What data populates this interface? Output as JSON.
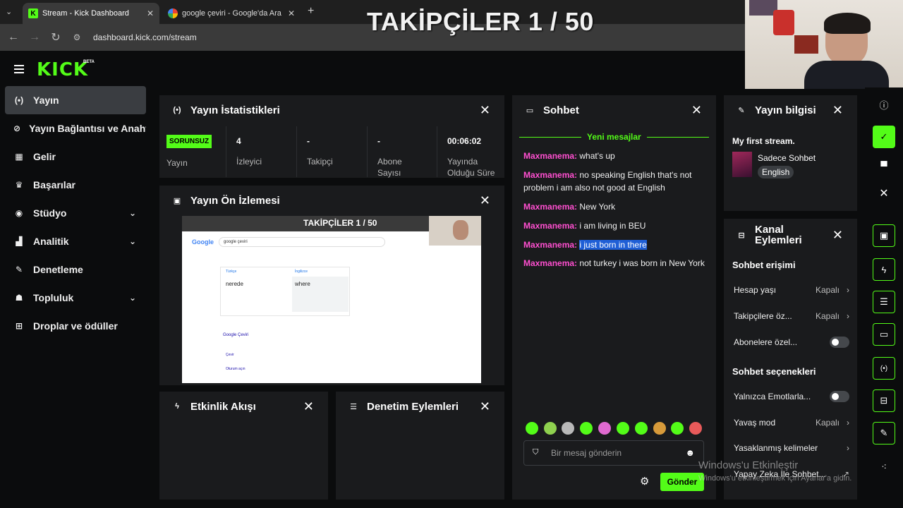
{
  "browser": {
    "tabs": [
      {
        "title": "Stream - Kick Dashboard"
      },
      {
        "title": "google çeviri - Google'da Ara"
      }
    ],
    "url": "dashboard.kick.com/stream"
  },
  "overlay": {
    "followers_title": "TAKİPÇİLER 1 / 50"
  },
  "header": {
    "logo": "KICK",
    "beta": "BETA"
  },
  "sidebar": {
    "items": [
      {
        "label": "Yayın",
        "icon": "broadcast-icon"
      },
      {
        "label": "Yayın Bağlantısı ve Anahtarı",
        "icon": "link-icon"
      },
      {
        "label": "Gelir",
        "icon": "revenue-icon"
      },
      {
        "label": "Başarılar",
        "icon": "trophy-icon"
      },
      {
        "label": "Stüdyo",
        "icon": "studio-icon"
      },
      {
        "label": "Analitik",
        "icon": "analytics-icon"
      },
      {
        "label": "Denetleme",
        "icon": "wrench-icon"
      },
      {
        "label": "Topluluk",
        "icon": "community-icon"
      },
      {
        "label": "Droplar ve ödüller",
        "icon": "drops-icon"
      }
    ]
  },
  "stats_panel": {
    "title": "Yayın İstatistikleri",
    "status_badge": "SORUNSUZ",
    "stats": [
      {
        "value": "",
        "label": "Yayın"
      },
      {
        "value": "4",
        "label": "İzleyici"
      },
      {
        "value": "-",
        "label": "Takipçi"
      },
      {
        "value": "-",
        "label": "Abone Sayısı"
      },
      {
        "value": "00:06:02",
        "label": "Yayında Olduğu Süre"
      }
    ]
  },
  "preview_panel": {
    "title": "Yayın Ön İzlemesi",
    "preview_overlay": "TAKİPÇİLER 1 / 50",
    "preview_search": "google çeviri",
    "preview_left_lang": "Türkçe",
    "preview_right_lang": "İngilizce",
    "preview_source_text": "nerede",
    "preview_translation": "where",
    "preview_result_title": "Google Çeviri",
    "preview_link1": "Çevir",
    "preview_link2": "Oturum açın"
  },
  "activity_panel": {
    "title": "Etkinlik Akışı"
  },
  "moderation_panel": {
    "title": "Denetim Eylemleri"
  },
  "chat_panel": {
    "title": "Sohbet",
    "new_messages": "Yeni mesajlar",
    "messages": [
      {
        "user": "Maxmanema",
        "text": "what's up"
      },
      {
        "user": "Maxmanema",
        "text": "no speaking English that's not problem i am also not good at English"
      },
      {
        "user": "Maxmanema",
        "text": "New York"
      },
      {
        "user": "Maxmanema",
        "text": "i am living in BEU"
      },
      {
        "user": "Maxmanema",
        "text": "i just born in there"
      },
      {
        "user": "Maxmanema",
        "text": "not turkey i was born in New York"
      }
    ],
    "input_placeholder": "Bir mesaj gönderin",
    "send_label": "Gönder"
  },
  "stream_info_panel": {
    "title": "Yayın bilgisi",
    "stream_title": "My first stream.",
    "category": "Sadece Sohbet",
    "language": "English"
  },
  "channel_actions_panel": {
    "title": "Kanal Eylemleri",
    "chat_access_heading": "Sohbet erişimi",
    "account_age": {
      "label": "Hesap yaşı",
      "value": "Kapalı"
    },
    "followers_only": {
      "label": "Takipçilere öz...",
      "value": "Kapalı"
    },
    "subscribers_only": {
      "label": "Abonelere özel..."
    },
    "chat_options_heading": "Sohbet seçenekleri",
    "emotes_only": {
      "label": "Yalnızca Emotlarla..."
    },
    "slow_mode": {
      "label": "Yavaş mod",
      "value": "Kapalı"
    },
    "banned_words": {
      "label": "Yasaklanmış kelimeler"
    },
    "ai_chat": {
      "label": "Yapay Zeka İle Sohbet..."
    }
  },
  "windows_watermark": {
    "line1": "Windows'u Etkinleştir",
    "line2": "Windows'u etkinleştirmek için Ayarlar'a gidin."
  },
  "colors": {
    "accent": "#53fc18",
    "username": "#ff4fd0",
    "panel": "#1a1b1d",
    "background": "#0b0c0d"
  }
}
